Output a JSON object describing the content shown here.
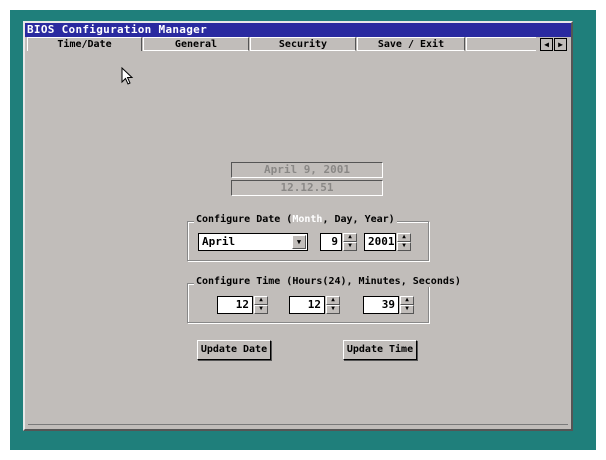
{
  "window": {
    "title": "BIOS Configuration Manager"
  },
  "tabs": [
    {
      "label": "Time/Date",
      "active": true
    },
    {
      "label": "General",
      "active": false
    },
    {
      "label": "Security",
      "active": false
    },
    {
      "label": "Save / Exit",
      "active": false
    }
  ],
  "tab_scroll": {
    "left_icon": "arrow-left-icon",
    "right_icon": "arrow-right-icon"
  },
  "display": {
    "date": "April 9, 2001",
    "time": "12.12.51"
  },
  "date_group": {
    "legend_prefix": "Configure Date (",
    "legend_highlight": "Month",
    "legend_suffix": ", Day, Year)",
    "month": "April",
    "day": "9",
    "year": "2001"
  },
  "time_group": {
    "legend": "Configure Time (Hours(24), Minutes, Seconds)",
    "hours": "12",
    "minutes": "12",
    "seconds": "39"
  },
  "buttons": {
    "update_date": "Update Date",
    "update_time": "Update Time"
  },
  "colors": {
    "desktop": "#1f7f7b",
    "titlebar": "#2a2aa0",
    "panel": "#c1bdba"
  }
}
